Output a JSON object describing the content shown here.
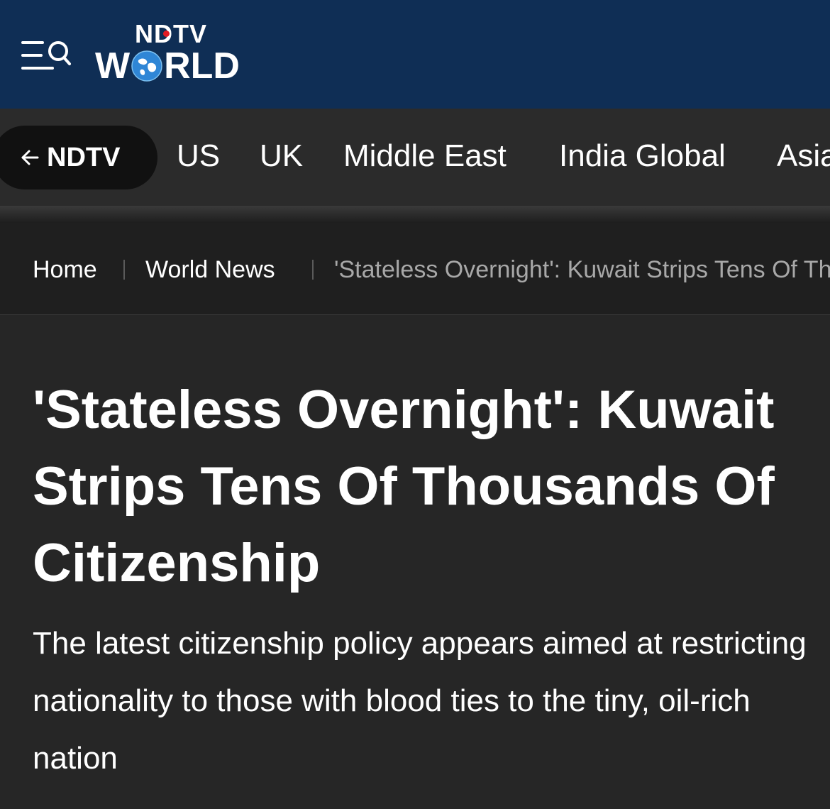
{
  "header": {
    "logo_top": "NDTV",
    "logo_world_left": "W",
    "logo_world_right": "RLD",
    "background_color": "#0f2e55"
  },
  "nav": {
    "back_label": "NDTV",
    "back_icon": "arrow-left-icon",
    "items": [
      "US",
      "UK",
      "Middle East",
      "India Global",
      "Asia"
    ]
  },
  "breadcrumb": {
    "home": "Home",
    "section": "World News",
    "current": "'Stateless Overnight': Kuwait Strips Tens Of Thousands Of Citizenship"
  },
  "article": {
    "headline": "'Stateless Overnight': Kuwait Strips Tens Of Thousands Of Citizenship",
    "summary": "The latest citizenship policy appears aimed at restricting nationality to those with blood ties to the tiny, oil-rich nation"
  },
  "colors": {
    "header_bg": "#0f2e55",
    "accent_red": "#e21b23",
    "page_bg": "#262626"
  }
}
